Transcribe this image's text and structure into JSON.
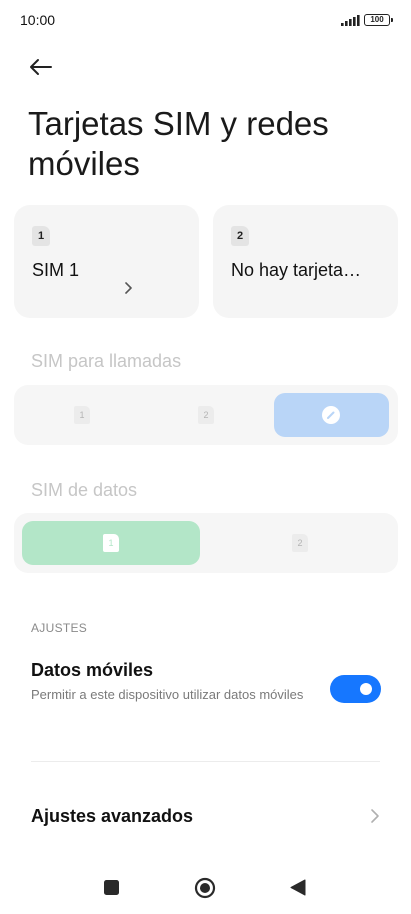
{
  "status_bar": {
    "time": "10:00",
    "battery_level": "100",
    "icons": [
      "signal-icon",
      "battery-icon"
    ]
  },
  "header": {
    "back_icon": "arrow-left-icon",
    "title": "Tarjetas SIM y redes móviles"
  },
  "sim_cards": [
    {
      "slot": "1",
      "name": "SIM 1",
      "chevron_icon": "chevron-down-icon"
    },
    {
      "slot": "2",
      "name": "No hay tarjeta…"
    }
  ],
  "calls_section": {
    "label": "SIM para llamadas",
    "options": [
      {
        "value": "1",
        "selected": false
      },
      {
        "value": "2",
        "selected": false
      },
      {
        "icon": "pencil-icon",
        "selected": true
      }
    ],
    "selected_color": "#b9d5f7"
  },
  "data_section": {
    "label": "SIM de datos",
    "options": [
      {
        "value": "1",
        "selected": true
      },
      {
        "value": "2",
        "selected": false
      }
    ],
    "selected_color": "#b3e6c8"
  },
  "settings": {
    "header": "AJUSTES",
    "mobile_data": {
      "title": "Datos móviles",
      "description": "Permitir a este dispositivo utilizar datos móviles",
      "enabled": true,
      "toggle_color": "#1677ff"
    },
    "advanced": {
      "label": "Ajustes avanzados",
      "chevron_icon": "chevron-right-icon"
    }
  },
  "nav_bar": {
    "buttons": [
      "recents-square-icon",
      "home-circle-icon",
      "back-triangle-icon"
    ]
  }
}
